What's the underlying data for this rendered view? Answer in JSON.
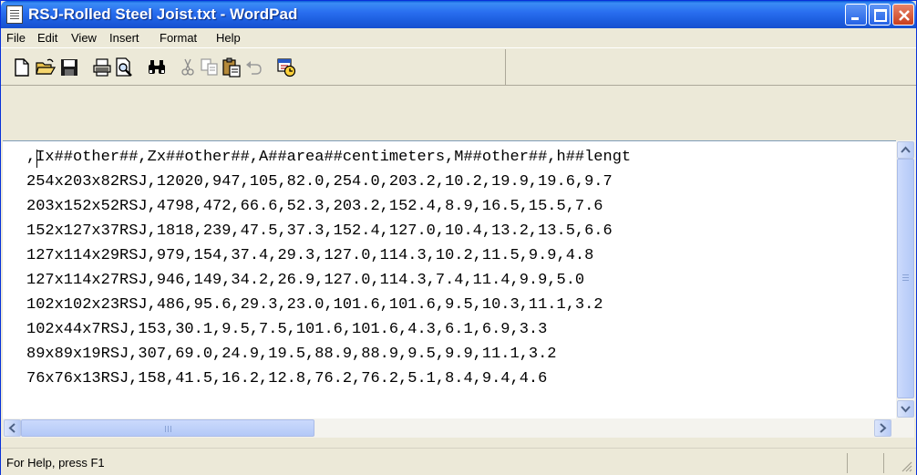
{
  "window": {
    "title": "RSJ-Rolled Steel Joist.txt - WordPad"
  },
  "menu": [
    {
      "label": "File"
    },
    {
      "label": "Edit"
    },
    {
      "label": "View"
    },
    {
      "label": "Insert"
    },
    {
      "label": "Format"
    },
    {
      "label": "Help"
    }
  ],
  "toolbar": {
    "icons": [
      "new-icon",
      "open-icon",
      "save-icon",
      "print-icon",
      "print-preview-icon",
      "find-icon",
      "cut-icon",
      "copy-icon",
      "paste-icon",
      "undo-icon",
      "date-time-icon"
    ]
  },
  "document": {
    "lines": [
      ",Ix##other##,Zx##other##,A##area##centimeters,M##other##,h##lengt",
      "254x203x82RSJ,12020,947,105,82.0,254.0,203.2,10.2,19.9,19.6,9.7",
      "203x152x52RSJ,4798,472,66.6,52.3,203.2,152.4,8.9,16.5,15.5,7.6",
      "152x127x37RSJ,1818,239,47.5,37.3,152.4,127.0,10.4,13.2,13.5,6.6",
      "127x114x29RSJ,979,154,37.4,29.3,127.0,114.3,10.2,11.5,9.9,4.8",
      "127x114x27RSJ,946,149,34.2,26.9,127.0,114.3,7.4,11.4,9.9,5.0",
      "102x102x23RSJ,486,95.6,29.3,23.0,101.6,101.6,9.5,10.3,11.1,3.2",
      "102x44x7RSJ,153,30.1,9.5,7.5,101.6,101.6,4.3,6.1,6.9,3.3",
      "89x89x19RSJ,307,69.0,24.9,19.5,88.9,88.9,9.5,9.9,11.1,3.2",
      "76x76x13RSJ,158,41.5,16.2,12.8,76.2,76.2,5.1,8.4,9.4,4.6"
    ]
  },
  "status": {
    "text": "For Help, press F1"
  }
}
